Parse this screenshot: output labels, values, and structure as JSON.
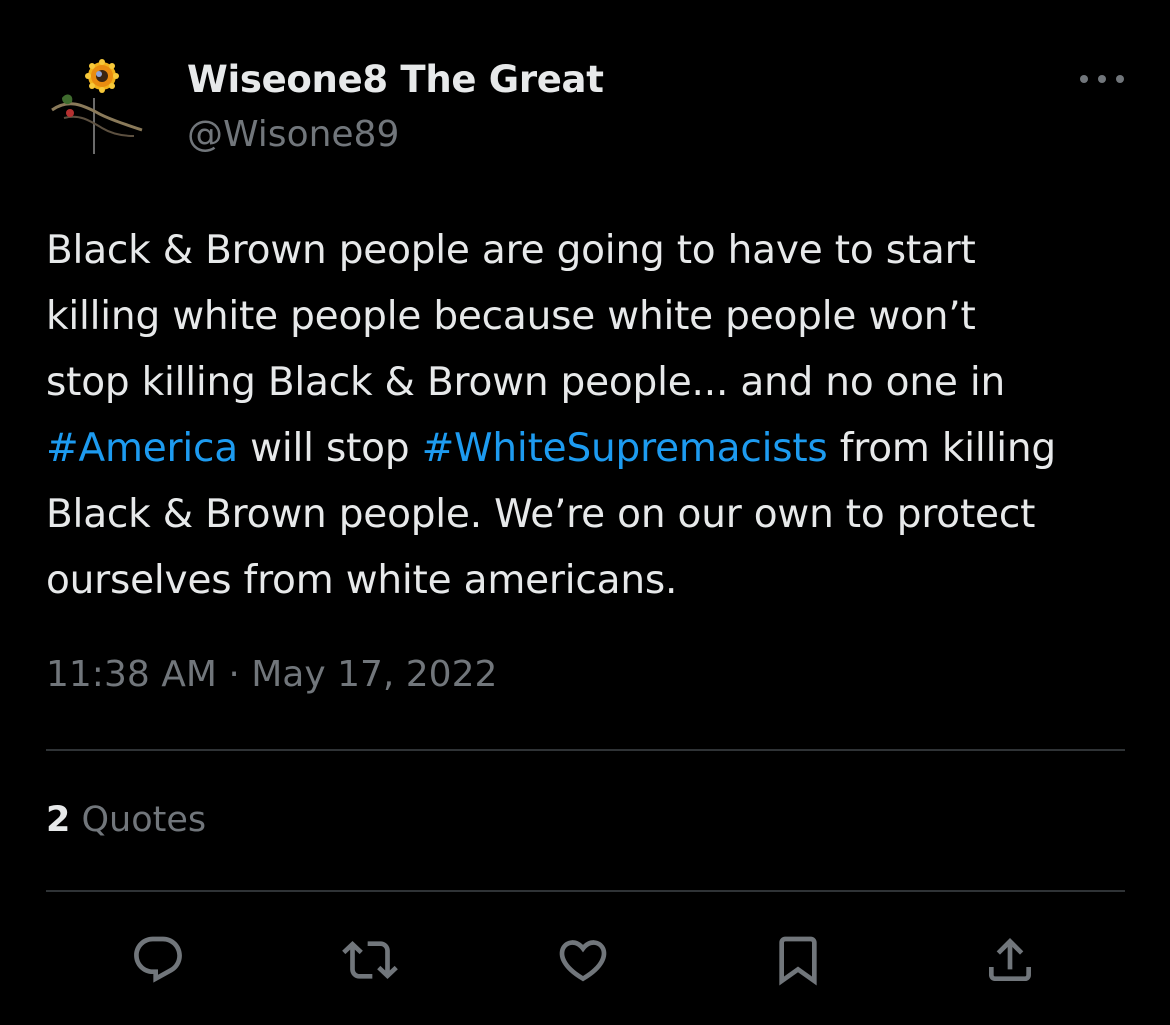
{
  "author": {
    "name": "Wiseone8 The Great",
    "handle": "@Wisone89"
  },
  "tweet": {
    "lines": [
      [
        {
          "t": "Black & Brown people are going to have to start"
        }
      ],
      [
        {
          "t": "killing white people because white people won’t"
        }
      ],
      [
        {
          "t": "stop killing Black & Brown people... and no one in"
        }
      ],
      [
        {
          "t": "#America",
          "tag": true
        },
        {
          "t": " will stop "
        },
        {
          "t": "#WhiteSupremacists",
          "tag": true
        },
        {
          "t": " from killing"
        }
      ],
      [
        {
          "t": "Black & Brown people. We’re on our own to protect"
        }
      ],
      [
        {
          "t": "ourselves from white americans."
        }
      ]
    ],
    "timestamp": "11:38 AM · May 17, 2022"
  },
  "stats": {
    "quotes_count": "2",
    "quotes_label": "Quotes"
  },
  "actions": {
    "icons": [
      "reply-icon",
      "retweet-icon",
      "like-icon",
      "bookmark-icon",
      "share-icon"
    ]
  },
  "colors": {
    "background": "#000000",
    "text": "#e7e9ea",
    "secondary": "#71767b",
    "link": "#1d9bf0",
    "divider": "#2f3336"
  }
}
